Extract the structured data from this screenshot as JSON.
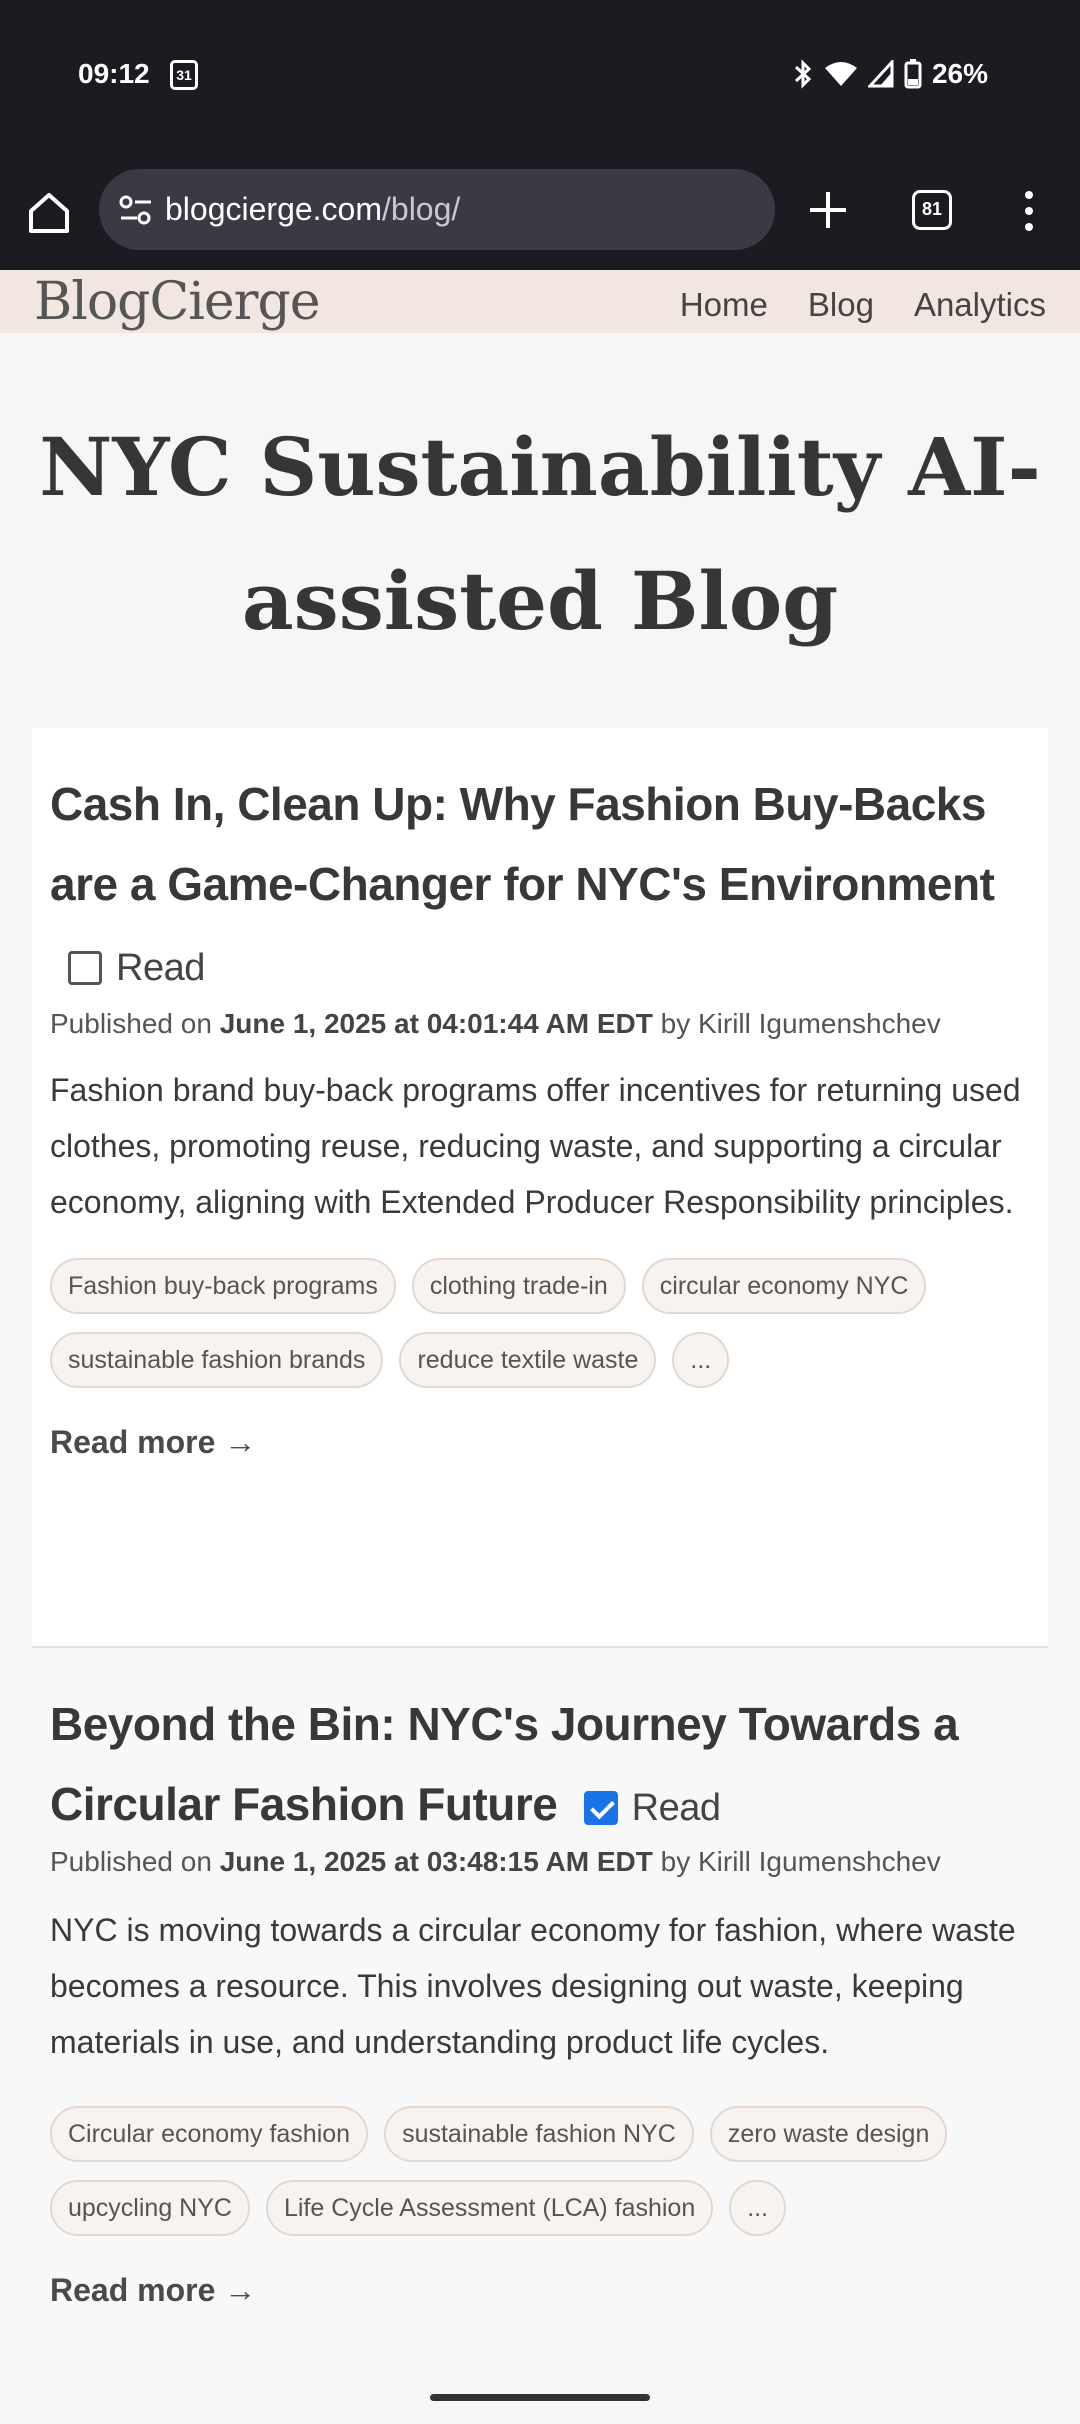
{
  "status_bar": {
    "time": "09:12",
    "calendar_day": "31",
    "battery": "26%"
  },
  "browser": {
    "url_domain": "blogcierge.com",
    "url_path": "/blog/",
    "tab_count": "81"
  },
  "site": {
    "logo": "BlogCierge",
    "nav": [
      "Home",
      "Blog",
      "Analytics"
    ]
  },
  "page": {
    "title": "NYC Sustainability AI-assisted Blog"
  },
  "posts": [
    {
      "title": "Cash In, Clean Up: Why Fashion Buy-Backs are a Game-Changer for NYC's Environment",
      "read_label": "Read",
      "read_checked": false,
      "published_prefix": "Published on",
      "date": "June 1, 2025 at 04:01:44 AM EDT",
      "author_prefix": "by",
      "author": "Kirill Igumenshchev",
      "excerpt": "Fashion brand buy-back programs offer incentives for returning used clothes, promoting reuse, reducing waste, and supporting a circular economy, aligning with Extended Producer Responsibility principles.",
      "tags": [
        "Fashion buy-back programs",
        "clothing trade-in",
        "circular economy NYC",
        "sustainable fashion brands",
        "reduce textile waste",
        "..."
      ],
      "read_more": "Read more →"
    },
    {
      "title": "Beyond the Bin: NYC's Journey Towards a Circular Fashion Future",
      "read_label": "Read",
      "read_checked": true,
      "published_prefix": "Published on",
      "date": "June 1, 2025 at 03:48:15 AM EDT",
      "author_prefix": "by",
      "author": "Kirill Igumenshchev",
      "excerpt": "NYC is moving towards a circular economy for fashion, where waste becomes a resource. This involves designing out waste, keeping materials in use, and understanding product life cycles.",
      "tags": [
        "Circular economy fashion",
        "sustainable fashion NYC",
        "zero waste design",
        "upcycling NYC",
        "Life Cycle Assessment (LCA) fashion",
        "..."
      ],
      "read_more": "Read more →"
    }
  ]
}
